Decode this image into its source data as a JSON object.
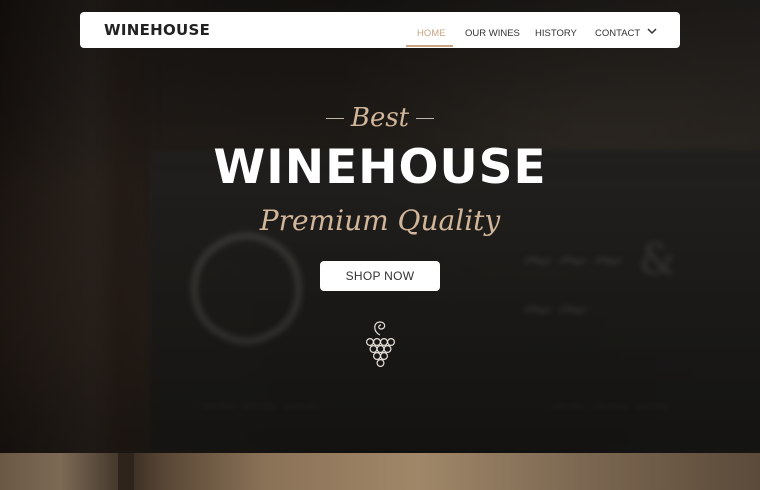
{
  "navbar": {
    "brand": "WINEHOUSE",
    "items": [
      {
        "label": "HOME",
        "active": true
      },
      {
        "label": "OUR WINES",
        "active": false
      },
      {
        "label": "HISTORY",
        "active": false
      },
      {
        "label": "CONTACT",
        "active": false
      }
    ],
    "dropdown_icon": "chevron-down-icon"
  },
  "hero": {
    "kicker": "Best",
    "title": "WINEHOUSE",
    "subtitle": "Premium Quality",
    "cta_label": "SHOP NOW",
    "emblem_icon": "grape-icon"
  },
  "colors": {
    "accent": "#c9a583",
    "script_text": "#d2b69a",
    "navbar_bg": "#ffffff",
    "hero_title": "#ffffff"
  }
}
